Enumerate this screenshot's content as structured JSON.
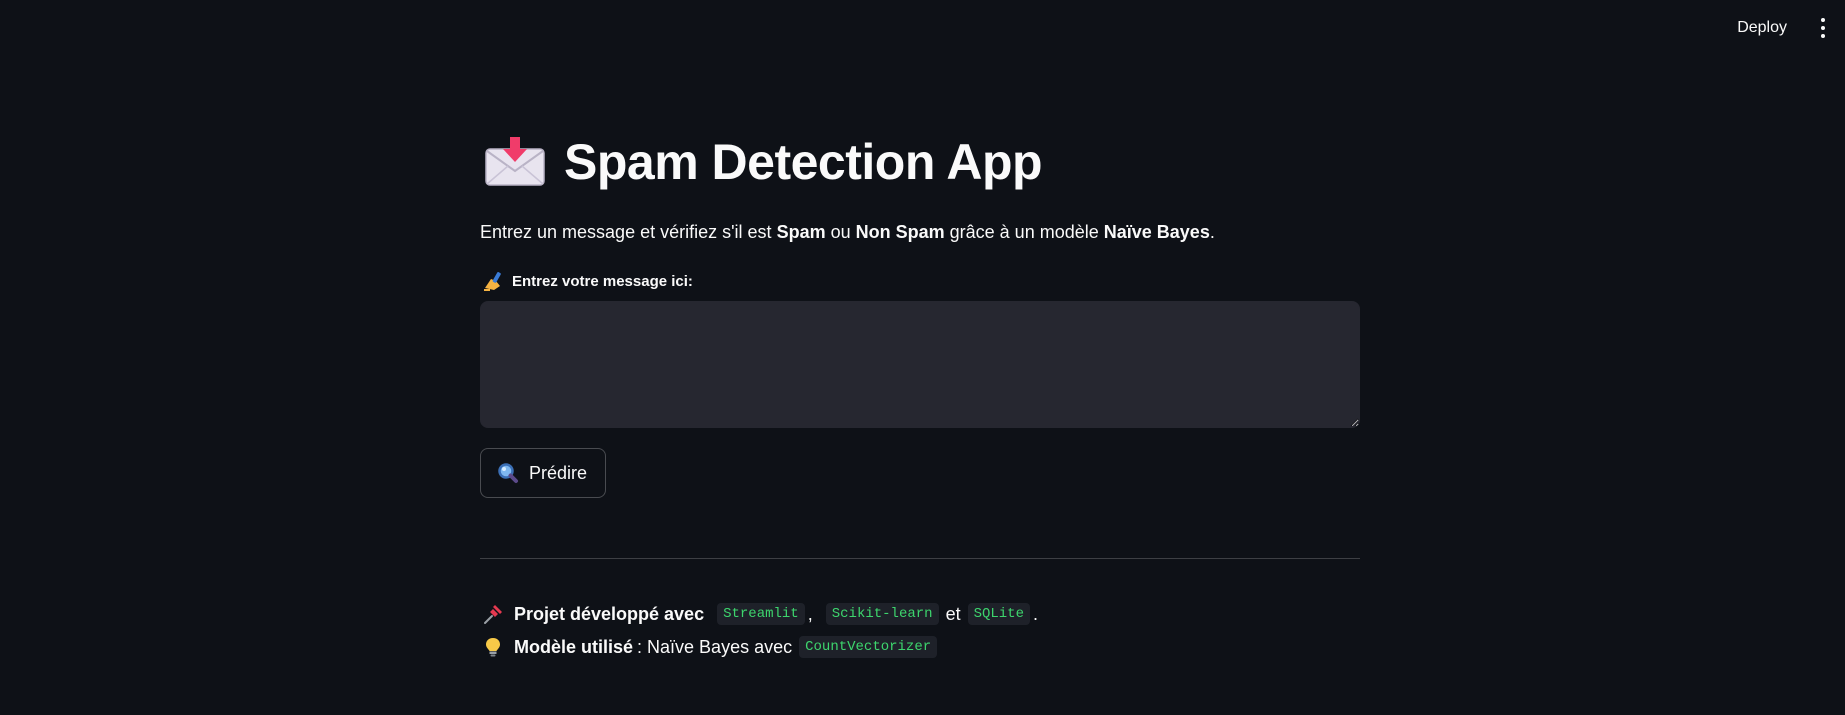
{
  "header": {
    "deploy_label": "Deploy",
    "menu_icon": "vertical-ellipsis-icon"
  },
  "main": {
    "title_icon": "envelope-download-icon",
    "title": "Spam Detection App",
    "intro": {
      "part1": "Entrez un message et vérifiez s'il est ",
      "spam": "Spam",
      "part2": " ou ",
      "non_spam": "Non Spam",
      "part3": " grâce à un modèle ",
      "model": "Naïve Bayes",
      "part4": "."
    },
    "input": {
      "icon": "writing-hand-icon",
      "label": "Entrez votre message ici:",
      "value": "",
      "placeholder": ""
    },
    "predict_button": {
      "icon": "magnifier-icon",
      "label": "Prédire"
    }
  },
  "footer": {
    "line1": {
      "icon": "pushpin-icon",
      "bold": "Projet développé avec",
      "tag1": "Streamlit",
      "sep1": ",",
      "tag2": "Scikit-learn",
      "sep2": "et",
      "tag3": "SQLite",
      "end": "."
    },
    "line2": {
      "icon": "lightbulb-icon",
      "bold": "Modèle utilisé",
      "text": ": Naïve Bayes avec",
      "tag": "CountVectorizer"
    }
  },
  "colors": {
    "background": "#0e1117",
    "text": "#fafafa",
    "input_bg": "#262730",
    "code_text": "#3dd56d",
    "code_bg": "#1e2129"
  }
}
